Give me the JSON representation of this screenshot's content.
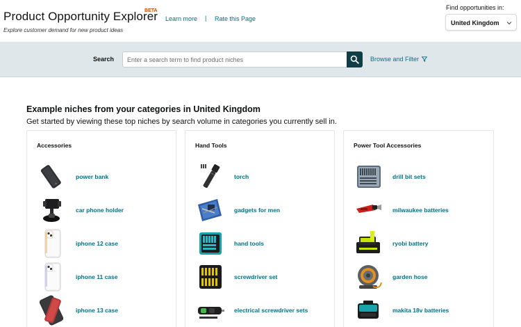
{
  "header": {
    "title": "Product Opportunity Explorer",
    "beta": "BETA",
    "subtitle": "Explore customer demand for new product ideas",
    "learn_more": "Learn more",
    "divider": "|",
    "rate_page": "Rate this Page",
    "find_label": "Find opportunities in:",
    "country": "United Kingdom",
    "chevron_icon": "chevron-down-icon"
  },
  "search": {
    "label": "Search",
    "placeholder": "Enter a search term to find product niches",
    "button_icon": "search-icon",
    "browse_label": "Browse and Filter",
    "browse_icon": "filter-icon"
  },
  "section": {
    "title": "Example niches from your categories in United Kingdom",
    "description": "Get started by viewing these top niches by search volume in categories you currently sell in."
  },
  "cards": [
    {
      "title": "Accessories",
      "items": [
        {
          "label": "power bank",
          "icon": "power-bank-image"
        },
        {
          "label": "car phone holder",
          "icon": "car-phone-holder-image"
        },
        {
          "label": "iphone 12 case",
          "icon": "phone-case-image"
        },
        {
          "label": "iphone 11 case",
          "icon": "phone-case-image"
        },
        {
          "label": "iphone 13 case",
          "icon": "phone-case-image"
        }
      ]
    },
    {
      "title": "Hand Tools",
      "items": [
        {
          "label": "torch",
          "icon": "torch-image"
        },
        {
          "label": "gadgets for men",
          "icon": "tool-kit-image"
        },
        {
          "label": "hand tools",
          "icon": "tool-case-image"
        },
        {
          "label": "screwdriver set",
          "icon": "screwdriver-set-image"
        },
        {
          "label": "electrical screwdriver sets",
          "icon": "electric-screwdriver-image"
        }
      ]
    },
    {
      "title": "Power Tool Accessories",
      "items": [
        {
          "label": "drill bit sets",
          "icon": "drill-bit-set-image"
        },
        {
          "label": "milwaukee batteries",
          "icon": "multi-tool-image"
        },
        {
          "label": "ryobi battery",
          "icon": "battery-charger-image"
        },
        {
          "label": "garden hose",
          "icon": "hose-reel-image"
        },
        {
          "label": "makita 18v batteries",
          "icon": "battery-image"
        }
      ]
    }
  ],
  "colors": {
    "link": "#007185",
    "beta": "#c45500",
    "search_band": "#dfe7ea",
    "search_button": "#0f3e47"
  }
}
